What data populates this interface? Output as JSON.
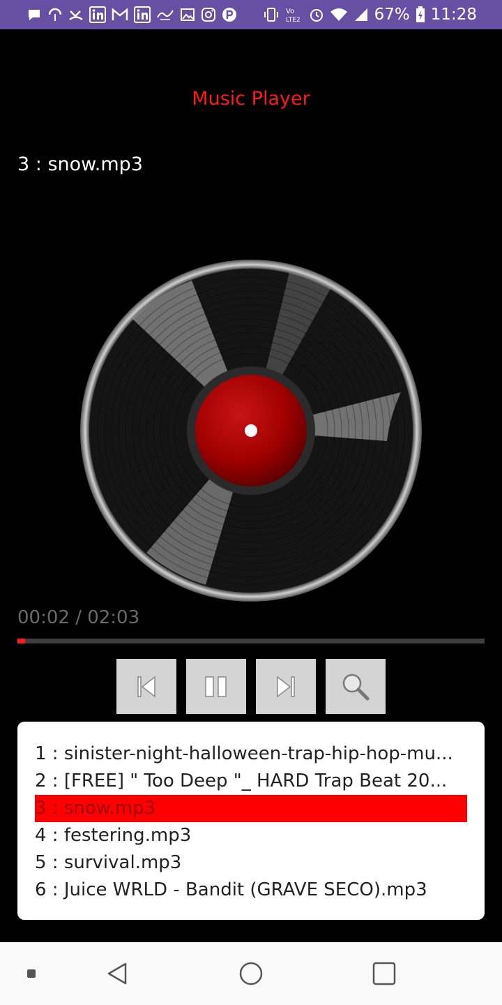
{
  "status_bar": {
    "battery": "67%",
    "time": "11:28",
    "color": "#6750a4",
    "left_icons": [
      "chat-bubble-icon",
      "hotspot-icon",
      "missed-call-icon",
      "linkedin-icon",
      "gmail-icon",
      "linkedin-icon",
      "food-app-icon",
      "gallery-icon",
      "instagram-icon",
      "paytm-icon"
    ],
    "right_icons": [
      "vibrate-icon",
      "volte-icon",
      "alarm-icon",
      "wifi-icon",
      "signal-icon",
      "battery-icon"
    ]
  },
  "app": {
    "title": "Music Player",
    "accent_color": "#ff1a1a"
  },
  "now_playing": "3 : snow.mp3",
  "player": {
    "time_label": "00:02 / 02:03",
    "progress_fraction": 0.016,
    "controls": [
      {
        "name": "previous-button",
        "icon": "skip-previous-icon"
      },
      {
        "name": "pause-button",
        "icon": "pause-icon"
      },
      {
        "name": "next-button",
        "icon": "skip-next-icon"
      },
      {
        "name": "search-button",
        "icon": "search-icon"
      }
    ]
  },
  "playlist": {
    "items": [
      "1 : sinister-night-halloween-trap-hip-hop-mu...",
      "2 : [FREE] \" Too Deep \"_ HARD Trap Beat 20...",
      "3 : snow.mp3",
      "4 : festering.mp3",
      "5 : survival.mp3",
      "6 : Juice WRLD - Bandit (GRAVE SECO).mp3"
    ],
    "active_index": 2,
    "active_color": "#ff0000"
  },
  "nav_bar": {
    "icons": [
      "dot-icon",
      "back-icon",
      "home-icon",
      "recents-icon"
    ]
  }
}
